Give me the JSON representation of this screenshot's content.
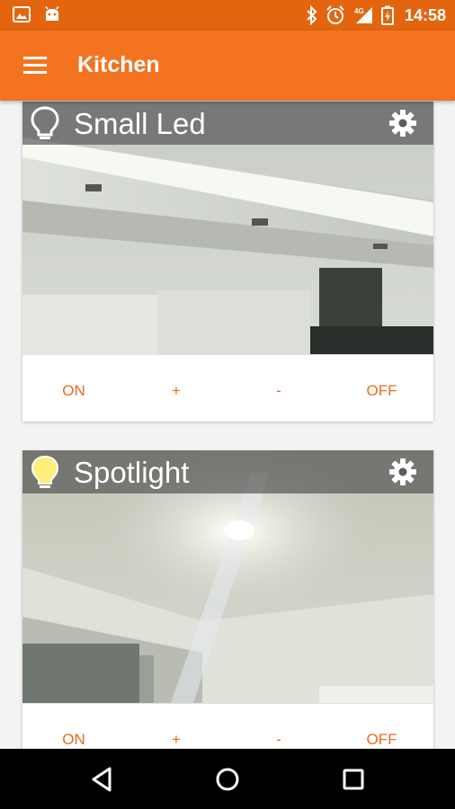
{
  "status_bar": {
    "time": "14:58",
    "icons": [
      "image-icon",
      "android-icon",
      "bluetooth-icon",
      "alarm-icon",
      "signal-4g-icon",
      "battery-charging-icon"
    ]
  },
  "app_bar": {
    "title": "Kitchen",
    "menu_icon": "hamburger-menu-icon"
  },
  "cards": [
    {
      "name": "Small Led",
      "bulb_state": "off",
      "actions": {
        "on": "ON",
        "plus": "+",
        "minus": "-",
        "off": "OFF"
      }
    },
    {
      "name": "Spotlight",
      "bulb_state": "on",
      "actions": {
        "on": "ON",
        "plus": "+",
        "minus": "-",
        "off": "OFF"
      }
    }
  ],
  "nav_bar": {
    "buttons": [
      "back-icon",
      "home-icon",
      "recents-icon"
    ]
  },
  "colors": {
    "status_bar": "#e3650f",
    "app_bar": "#f47321",
    "accent_text": "#e96d1c",
    "bulb_on": "#ffef7a"
  }
}
